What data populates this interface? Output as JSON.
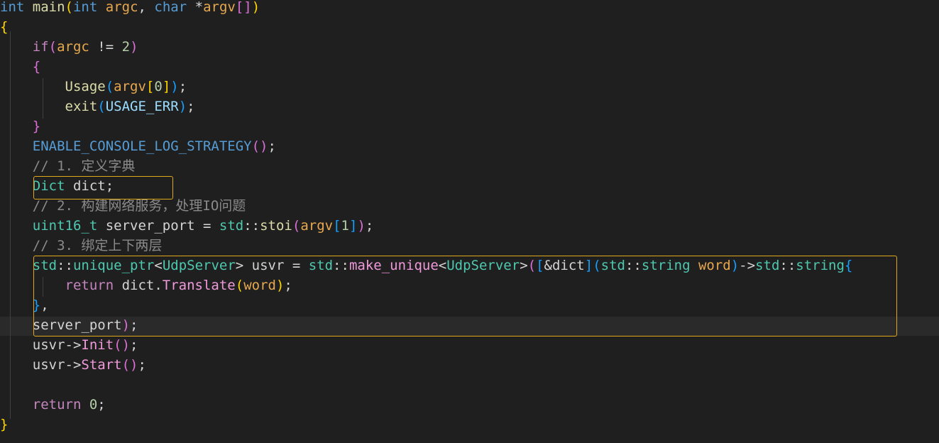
{
  "lines": [
    [
      [
        "int",
        "tok-keyword"
      ],
      [
        " main",
        "tok-function"
      ],
      [
        "(",
        "tok-brace"
      ],
      [
        "int",
        "tok-keyword"
      ],
      [
        " argc",
        "tok-param"
      ],
      [
        ", ",
        "tok-plain"
      ],
      [
        "char",
        "tok-keyword"
      ],
      [
        " *",
        "tok-plain"
      ],
      [
        "argv",
        "tok-param"
      ],
      [
        "[]",
        "tok-paren"
      ],
      [
        ")",
        "tok-brace"
      ]
    ],
    [
      [
        "{",
        "tok-brace"
      ]
    ],
    [
      [
        "    if",
        "tok-control"
      ],
      [
        "(",
        "tok-paren"
      ],
      [
        "argc",
        "tok-param"
      ],
      [
        " != ",
        "tok-plain"
      ],
      [
        "2",
        "tok-number"
      ],
      [
        ")",
        "tok-paren"
      ]
    ],
    [
      [
        "    {",
        "tok-paren"
      ]
    ],
    [
      [
        "        Usage",
        "tok-function"
      ],
      [
        "(",
        "tok-bracket"
      ],
      [
        "argv",
        "tok-param"
      ],
      [
        "[",
        "tok-brace"
      ],
      [
        "0",
        "tok-number"
      ],
      [
        "]",
        "tok-brace"
      ],
      [
        ")",
        "tok-bracket"
      ],
      [
        ";",
        "tok-plain"
      ]
    ],
    [
      [
        "        exit",
        "tok-function"
      ],
      [
        "(",
        "tok-bracket"
      ],
      [
        "USAGE_ERR",
        "tok-variable"
      ],
      [
        ")",
        "tok-bracket"
      ],
      [
        ";",
        "tok-plain"
      ]
    ],
    [
      [
        "    }",
        "tok-paren"
      ]
    ],
    [
      [
        "    ENABLE_CONSOLE_LOG_STRATEGY",
        "tok-macro"
      ],
      [
        "()",
        "tok-paren"
      ],
      [
        ";",
        "tok-plain"
      ]
    ],
    [
      [
        "    // 1. 定义字典",
        "tok-comment"
      ]
    ],
    [
      [
        "    Dict",
        "tok-type"
      ],
      [
        " dict;",
        "tok-plain"
      ]
    ],
    [
      [
        "    // 2. 构建网络服务，处理IO问题",
        "tok-comment"
      ]
    ],
    [
      [
        "    uint16_t",
        "tok-type"
      ],
      [
        " server_port = ",
        "tok-plain"
      ],
      [
        "std",
        "tok-type"
      ],
      [
        "::",
        "tok-plain"
      ],
      [
        "stoi",
        "tok-function"
      ],
      [
        "(",
        "tok-paren"
      ],
      [
        "argv",
        "tok-param"
      ],
      [
        "[",
        "tok-bracket"
      ],
      [
        "1",
        "tok-number"
      ],
      [
        "]",
        "tok-bracket"
      ],
      [
        ")",
        "tok-paren"
      ],
      [
        ";",
        "tok-plain"
      ]
    ],
    [
      [
        "    // 3. 绑定上下两层",
        "tok-comment"
      ]
    ],
    [
      [
        "    std",
        "tok-type"
      ],
      [
        "::",
        "tok-plain"
      ],
      [
        "unique_ptr",
        "tok-type"
      ],
      [
        "<",
        "tok-plain"
      ],
      [
        "UdpServer",
        "tok-type"
      ],
      [
        "> usvr = ",
        "tok-plain"
      ],
      [
        "std",
        "tok-type"
      ],
      [
        "::",
        "tok-plain"
      ],
      [
        "make_unique",
        "tok-method"
      ],
      [
        "<",
        "tok-plain"
      ],
      [
        "UdpServer",
        "tok-type"
      ],
      [
        ">",
        "tok-plain"
      ],
      [
        "(",
        "tok-paren"
      ],
      [
        "[",
        "tok-bracket"
      ],
      [
        "&dict",
        "tok-plain"
      ],
      [
        "]",
        "tok-bracket"
      ],
      [
        "(",
        "tok-bracket"
      ],
      [
        "std",
        "tok-type"
      ],
      [
        "::",
        "tok-plain"
      ],
      [
        "string",
        "tok-type"
      ],
      [
        " word",
        "tok-param"
      ],
      [
        ")",
        "tok-bracket"
      ],
      [
        "->",
        "tok-plain"
      ],
      [
        "std",
        "tok-type"
      ],
      [
        "::",
        "tok-plain"
      ],
      [
        "string",
        "tok-type"
      ],
      [
        "{",
        "tok-bracket"
      ]
    ],
    [
      [
        "        return",
        "tok-control"
      ],
      [
        " dict.",
        "tok-plain"
      ],
      [
        "Translate",
        "tok-method"
      ],
      [
        "(",
        "tok-brace"
      ],
      [
        "word",
        "tok-param"
      ],
      [
        ")",
        "tok-brace"
      ],
      [
        ";",
        "tok-plain"
      ]
    ],
    [
      [
        "    }",
        "tok-bracket"
      ],
      [
        ",",
        "tok-plain"
      ]
    ],
    [
      [
        "    server_port",
        "tok-plain"
      ],
      [
        ")",
        "tok-paren"
      ],
      [
        ";",
        "tok-plain"
      ]
    ],
    [
      [
        "    usvr->",
        "tok-plain"
      ],
      [
        "Init",
        "tok-method"
      ],
      [
        "()",
        "tok-paren"
      ],
      [
        ";",
        "tok-plain"
      ]
    ],
    [
      [
        "    usvr->",
        "tok-plain"
      ],
      [
        "Start",
        "tok-method"
      ],
      [
        "()",
        "tok-paren"
      ],
      [
        ";",
        "tok-plain"
      ]
    ],
    [
      [
        "",
        "tok-plain"
      ]
    ],
    [
      [
        "    return",
        "tok-control"
      ],
      [
        " ",
        "tok-plain"
      ],
      [
        "0",
        "tok-number"
      ],
      [
        ";",
        "tok-plain"
      ]
    ],
    [
      [
        "}",
        "tok-brace"
      ]
    ]
  ],
  "colors": {
    "background": "#1f1f1f",
    "current_line": "#2a2a2a",
    "highlight_box": "#e0a81b"
  }
}
